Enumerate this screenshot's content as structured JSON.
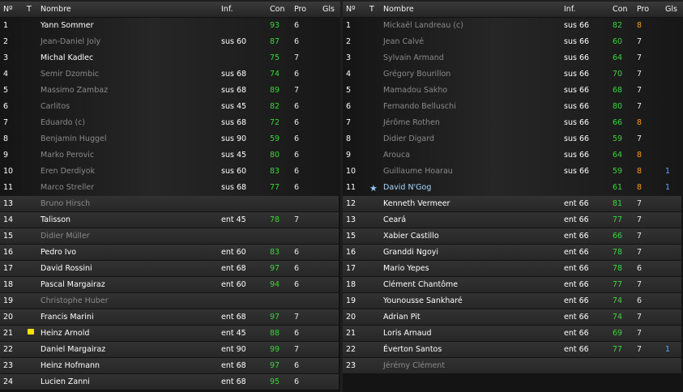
{
  "headers": {
    "num": "Nº",
    "t": "T",
    "name": "Nombre",
    "inf": "Inf.",
    "con": "Con",
    "pro": "Pro",
    "gls": "Gls"
  },
  "left": {
    "starters": [
      {
        "num": "1",
        "name": "Yann Sommer",
        "inf": "",
        "con": "93",
        "pro": "6",
        "gls": "",
        "style": "bright",
        "pro_color": "white"
      },
      {
        "num": "2",
        "name": "Jean-Daniel Joly",
        "inf": "sus 60",
        "con": "87",
        "pro": "6",
        "gls": "",
        "style": "dim",
        "pro_color": "white"
      },
      {
        "num": "3",
        "name": "Michal Kadlec",
        "inf": "",
        "con": "75",
        "pro": "7",
        "gls": "",
        "style": "bright",
        "pro_color": "white"
      },
      {
        "num": "4",
        "name": "Semir Dzombic",
        "inf": "sus 68",
        "con": "74",
        "pro": "6",
        "gls": "",
        "style": "dim",
        "pro_color": "white"
      },
      {
        "num": "5",
        "name": "Massimo Zambaz",
        "inf": "sus 68",
        "con": "89",
        "pro": "7",
        "gls": "",
        "style": "dim",
        "pro_color": "white"
      },
      {
        "num": "6",
        "name": "Carlitos",
        "inf": "sus 45",
        "con": "82",
        "pro": "6",
        "gls": "",
        "style": "dim",
        "pro_color": "white"
      },
      {
        "num": "7",
        "name": "Eduardo (c)",
        "inf": "sus 68",
        "con": "72",
        "pro": "6",
        "gls": "",
        "style": "dim",
        "pro_color": "white"
      },
      {
        "num": "8",
        "name": "Benjamin Huggel",
        "inf": "sus 90",
        "con": "59",
        "pro": "6",
        "gls": "",
        "style": "dim",
        "pro_color": "white"
      },
      {
        "num": "9",
        "name": "Marko Perovic",
        "inf": "sus 45",
        "con": "80",
        "pro": "6",
        "gls": "",
        "style": "dim",
        "pro_color": "white"
      },
      {
        "num": "10",
        "name": "Eren Derdiyok",
        "inf": "sus 60",
        "con": "83",
        "pro": "6",
        "gls": "",
        "style": "dim",
        "pro_color": "white"
      },
      {
        "num": "11",
        "name": "Marco Streller",
        "inf": "sus 68",
        "con": "77",
        "pro": "6",
        "gls": "",
        "style": "dim",
        "pro_color": "white"
      }
    ],
    "subs": [
      {
        "num": "13",
        "name": "Bruno Hirsch",
        "inf": "",
        "con": "",
        "pro": "",
        "gls": "",
        "style": "dim"
      },
      {
        "num": "14",
        "name": "Talisson",
        "inf": "ent 45",
        "con": "78",
        "pro": "7",
        "gls": "",
        "style": "bright"
      },
      {
        "num": "15",
        "name": "Didier Müller",
        "inf": "",
        "con": "",
        "pro": "",
        "gls": "",
        "style": "dim"
      },
      {
        "num": "16",
        "name": "Pedro Ivo",
        "inf": "ent 60",
        "con": "83",
        "pro": "6",
        "gls": "",
        "style": "bright"
      },
      {
        "num": "17",
        "name": "David Rossini",
        "inf": "ent 68",
        "con": "97",
        "pro": "6",
        "gls": "",
        "style": "bright"
      },
      {
        "num": "18",
        "name": "Pascal Margairaz",
        "inf": "ent 60",
        "con": "94",
        "pro": "6",
        "gls": "",
        "style": "bright"
      },
      {
        "num": "19",
        "name": "Christophe Huber",
        "inf": "",
        "con": "",
        "pro": "",
        "gls": "",
        "style": "dim"
      },
      {
        "num": "20",
        "name": "Francis Marini",
        "inf": "ent 68",
        "con": "97",
        "pro": "7",
        "gls": "",
        "style": "bright"
      },
      {
        "num": "21",
        "name": "Heinz Arnold",
        "inf": "ent 45",
        "con": "88",
        "pro": "6",
        "gls": "",
        "style": "bright",
        "card": "yellow"
      },
      {
        "num": "22",
        "name": "Daniel Margairaz",
        "inf": "ent 90",
        "con": "99",
        "pro": "7",
        "gls": "",
        "style": "bright"
      },
      {
        "num": "23",
        "name": "Heinz Hofmann",
        "inf": "ent 68",
        "con": "97",
        "pro": "6",
        "gls": "",
        "style": "bright"
      },
      {
        "num": "24",
        "name": "Lucien Zanni",
        "inf": "ent 68",
        "con": "95",
        "pro": "6",
        "gls": "",
        "style": "bright"
      }
    ]
  },
  "right": {
    "starters": [
      {
        "num": "1",
        "name": "Mickaël Landreau (c)",
        "inf": "sus 66",
        "con": "82",
        "pro": "8",
        "gls": "",
        "style": "dim",
        "pro_color": "orange"
      },
      {
        "num": "2",
        "name": "Jean Calvé",
        "inf": "sus 66",
        "con": "60",
        "pro": "7",
        "gls": "",
        "style": "dim",
        "pro_color": "white"
      },
      {
        "num": "3",
        "name": "Sylvain Armand",
        "inf": "sus 66",
        "con": "64",
        "pro": "7",
        "gls": "",
        "style": "dim",
        "pro_color": "white"
      },
      {
        "num": "4",
        "name": "Grégory Bourillon",
        "inf": "sus 66",
        "con": "70",
        "pro": "7",
        "gls": "",
        "style": "dim",
        "pro_color": "white"
      },
      {
        "num": "5",
        "name": "Mamadou Sakho",
        "inf": "sus 66",
        "con": "68",
        "pro": "7",
        "gls": "",
        "style": "dim",
        "pro_color": "white"
      },
      {
        "num": "6",
        "name": "Fernando Belluschi",
        "inf": "sus 66",
        "con": "80",
        "pro": "7",
        "gls": "",
        "style": "dim",
        "pro_color": "white"
      },
      {
        "num": "7",
        "name": "Jérôme Rothen",
        "inf": "sus 66",
        "con": "66",
        "pro": "8",
        "gls": "",
        "style": "dim",
        "pro_color": "orange"
      },
      {
        "num": "8",
        "name": "Didier Digard",
        "inf": "sus 66",
        "con": "59",
        "pro": "7",
        "gls": "",
        "style": "dim",
        "pro_color": "white"
      },
      {
        "num": "9",
        "name": "Arouca",
        "inf": "sus 66",
        "con": "64",
        "pro": "8",
        "gls": "",
        "style": "dim",
        "pro_color": "orange"
      },
      {
        "num": "10",
        "name": "Guillaume Hoarau",
        "inf": "sus 66",
        "con": "59",
        "pro": "8",
        "gls": "1",
        "style": "dim",
        "pro_color": "orange"
      },
      {
        "num": "11",
        "name": "David N'Gog",
        "inf": "",
        "con": "61",
        "pro": "8",
        "gls": "1",
        "style": "star",
        "pro_color": "orange",
        "star": true
      }
    ],
    "subs": [
      {
        "num": "12",
        "name": "Kenneth Vermeer",
        "inf": "ent 66",
        "con": "81",
        "pro": "7",
        "gls": "",
        "style": "bright"
      },
      {
        "num": "13",
        "name": "Ceará",
        "inf": "ent 66",
        "con": "77",
        "pro": "7",
        "gls": "",
        "style": "bright"
      },
      {
        "num": "15",
        "name": "Xabier Castillo",
        "inf": "ent 66",
        "con": "66",
        "pro": "7",
        "gls": "",
        "style": "bright"
      },
      {
        "num": "16",
        "name": "Granddi Ngoyi",
        "inf": "ent 66",
        "con": "78",
        "pro": "7",
        "gls": "",
        "style": "bright"
      },
      {
        "num": "17",
        "name": "Mario Yepes",
        "inf": "ent 66",
        "con": "78",
        "pro": "6",
        "gls": "",
        "style": "bright"
      },
      {
        "num": "18",
        "name": "Clément Chantôme",
        "inf": "ent 66",
        "con": "77",
        "pro": "7",
        "gls": "",
        "style": "bright"
      },
      {
        "num": "19",
        "name": "Younousse Sankharé",
        "inf": "ent 66",
        "con": "74",
        "pro": "6",
        "gls": "",
        "style": "bright"
      },
      {
        "num": "20",
        "name": "Adrian Pit",
        "inf": "ent 66",
        "con": "74",
        "pro": "7",
        "gls": "",
        "style": "bright"
      },
      {
        "num": "21",
        "name": "Loris Arnaud",
        "inf": "ent 66",
        "con": "69",
        "pro": "7",
        "gls": "",
        "style": "bright"
      },
      {
        "num": "22",
        "name": "Éverton Santos",
        "inf": "ent 66",
        "con": "77",
        "pro": "7",
        "gls": "1",
        "style": "bright"
      },
      {
        "num": "23",
        "name": "Jérémy Clément",
        "inf": "",
        "con": "",
        "pro": "",
        "gls": "",
        "style": "dim"
      }
    ]
  },
  "colors": {
    "con": "#3cd43c",
    "pro_orange": "#ff9a1a",
    "goals": "#5aa6ff",
    "name_dim": "#8a8a8a",
    "name_star": "#a8d8ff",
    "yellow_card": "#f5e400"
  }
}
